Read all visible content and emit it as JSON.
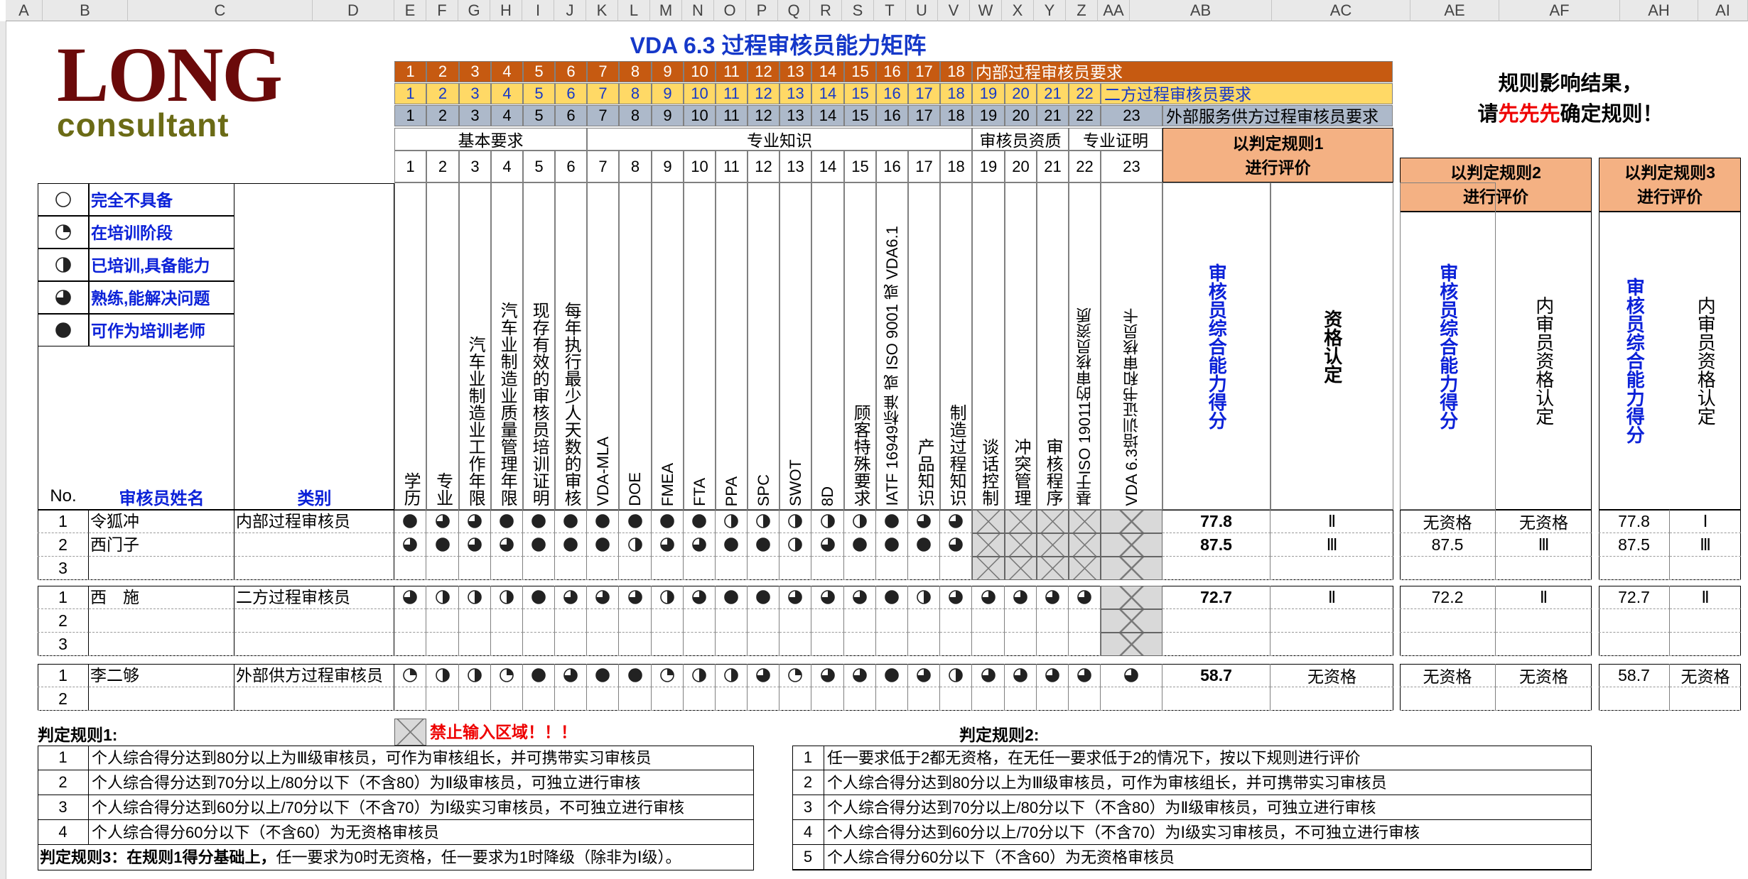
{
  "columns": [
    "A",
    "B",
    "C",
    "D",
    "E",
    "F",
    "G",
    "H",
    "I",
    "J",
    "K",
    "L",
    "M",
    "N",
    "O",
    "P",
    "Q",
    "R",
    "S",
    "T",
    "U",
    "V",
    "W",
    "X",
    "Y",
    "Z",
    "AA",
    "AB",
    "AC",
    "AE",
    "AF",
    "AH",
    "AI"
  ],
  "logo": {
    "top": "LONG",
    "bottom": "consultant"
  },
  "title": "VDA 6.3 过程审核员能力矩阵",
  "req_rows": {
    "internal": "内部过程审核员要求",
    "second": "二方过程审核员要求",
    "external": "外部服务供方过程审核员要求"
  },
  "colors": {
    "internal": "#c65a11",
    "second": "#ffd966",
    "external": "#adb9ca",
    "peach": "#f4b183",
    "hatch": "#d9d9d9",
    "blue": "#0b21d8"
  },
  "groups": {
    "basic": "基本要求",
    "pro": "专业知识",
    "qual": "审核员资质",
    "cert": "专业证明"
  },
  "notice": {
    "line1": "规则影响结果，",
    "line2_pre": "请",
    "line2_red": "先先先",
    "line2_post": "确定规则！"
  },
  "rule1_head": {
    "l1": "以判定规则1",
    "l2": "进行评价"
  },
  "rule2_head": {
    "l1": "以判定规则2",
    "l2": "进行评价"
  },
  "rule3_head": {
    "l1": "以判定规则3",
    "l2": "进行评价"
  },
  "legend": [
    {
      "level": 0,
      "label": "完全不具备"
    },
    {
      "level": 1,
      "label": "在培训阶段"
    },
    {
      "level": 2,
      "label": "已培训,具备能力"
    },
    {
      "level": 3,
      "label": "熟练,能解决问题"
    },
    {
      "level": 4,
      "label": "可作为培训老师"
    }
  ],
  "headers": {
    "no": "No.",
    "name": "审核员姓名",
    "category": "类别",
    "score": "审核员综合能力得分",
    "qual": "资格认定",
    "internal_qual": "内审员资格认定",
    "req": [
      "学历",
      "专业",
      "汽车业制造业工作年限",
      "汽车业制造业质量管理年限",
      "现存有效的审核员培训证明",
      "每年执行最少人天数的审核",
      "VDA-MLA",
      "DOE",
      "FMEA",
      "FTA",
      "PPA",
      "SPC",
      "SWOT",
      "8D",
      "顾客特殊要求",
      "IATF 16949标准 或 ISO 9001 或 VDA6.1",
      "产品知识",
      "制造过程知识",
      "谈话控制",
      "冲突管理",
      "审核程序",
      "基于ISO 19011的审核员资质",
      "VDA 6.3培训证书和审核员卡"
    ]
  },
  "groups_data": [
    {
      "category": "内部过程审核员",
      "rows": [
        {
          "no": "1",
          "name": "令狐冲",
          "levels": [
            4,
            3,
            3,
            4,
            4,
            4,
            4,
            4,
            4,
            4,
            2,
            2,
            2,
            2,
            2,
            4,
            3,
            3
          ],
          "score": "77.8",
          "qual": "Ⅱ",
          "r2_score": "无资格",
          "r2_qual": "无资格",
          "r3_score": "77.8",
          "r3_qual": "Ⅰ"
        },
        {
          "no": "2",
          "name": "西门子",
          "levels": [
            3,
            4,
            3,
            3,
            4,
            4,
            4,
            2,
            3,
            3,
            4,
            4,
            2,
            3,
            4,
            4,
            4,
            3
          ],
          "score": "87.5",
          "qual": "Ⅲ",
          "r2_score": "87.5",
          "r2_qual": "Ⅲ",
          "r3_score": "87.5",
          "r3_qual": "Ⅲ"
        },
        {
          "no": "3",
          "name": "",
          "levels": [],
          "score": "",
          "qual": "",
          "r2_score": "",
          "r2_qual": "",
          "r3_score": "",
          "r3_qual": ""
        }
      ]
    },
    {
      "category": "二方过程审核员",
      "rows": [
        {
          "no": "1",
          "name": "西　施",
          "levels": [
            3,
            2,
            2,
            2,
            4,
            3,
            3,
            3,
            2,
            3,
            4,
            4,
            3,
            3,
            3,
            4,
            2,
            3,
            3,
            3,
            3,
            3
          ],
          "score": "72.7",
          "qual": "Ⅱ",
          "r2_score": "72.2",
          "r2_qual": "Ⅱ",
          "r3_score": "72.7",
          "r3_qual": "Ⅱ"
        },
        {
          "no": "2",
          "name": "",
          "levels": [],
          "score": "",
          "qual": "",
          "r2_score": "",
          "r2_qual": "",
          "r3_score": "",
          "r3_qual": ""
        },
        {
          "no": "3",
          "name": "",
          "levels": [],
          "score": "",
          "qual": "",
          "r2_score": "",
          "r2_qual": "",
          "r3_score": "",
          "r3_qual": ""
        }
      ]
    },
    {
      "category": "外部供方过程审核员",
      "rows": [
        {
          "no": "1",
          "name": "李二够",
          "levels": [
            1,
            2,
            2,
            1,
            4,
            3,
            4,
            4,
            1,
            2,
            2,
            3,
            1,
            3,
            3,
            4,
            3,
            2,
            3,
            3,
            3,
            3,
            3
          ],
          "score": "58.7",
          "qual": "无资格",
          "r2_score": "无资格",
          "r2_qual": "无资格",
          "r3_score": "58.7",
          "r3_qual": "无资格"
        },
        {
          "no": "2",
          "name": "",
          "levels": [],
          "score": "",
          "qual": "",
          "r2_score": "",
          "r2_qual": "",
          "r3_score": "",
          "r3_qual": ""
        }
      ]
    }
  ],
  "forbidden": "禁止输入区域！！！",
  "rule1_title": "判定规则1:",
  "rule1": [
    {
      "no": "1",
      "text": "个人综合得分达到80分以上为Ⅲ级审核员，可作为审核组长，并可携带实习审核员"
    },
    {
      "no": "2",
      "text": "个人综合得分达到70分以上/80分以下（不含80）为Ⅱ级审核员，可独立进行审核"
    },
    {
      "no": "3",
      "text": "个人综合得分达到60分以上/70分以下（不含70）为Ⅰ级实习审核员，不可独立进行审核"
    },
    {
      "no": "4",
      "text": "个人综合得分60分以下（不含60）为无资格审核员"
    }
  ],
  "rule3": {
    "bold": "判定规则3：在规则1得分基础上，",
    "text": "任一要求为0时无资格，任一要求为1时降级（除非为Ⅰ级）。"
  },
  "rule2_title": "判定规则2:",
  "rule2": [
    {
      "no": "1",
      "text": "任一要求低于2都无资格，在无任一要求低于2的情况下，按以下规则进行评价"
    },
    {
      "no": "2",
      "text": "个人综合得分达到80分以上为Ⅲ级审核员，可作为审核组长，并可携带实习审核员"
    },
    {
      "no": "3",
      "text": "个人综合得分达到70分以上/80分以下（不含80）为Ⅱ级审核员，可独立进行审核"
    },
    {
      "no": "4",
      "text": "个人综合得分达到60分以上/70分以下（不含70）为Ⅰ级实习审核员，不可独立进行审核"
    },
    {
      "no": "5",
      "text": "个人综合得分60分以下（不含60）为无资格审核员"
    }
  ]
}
